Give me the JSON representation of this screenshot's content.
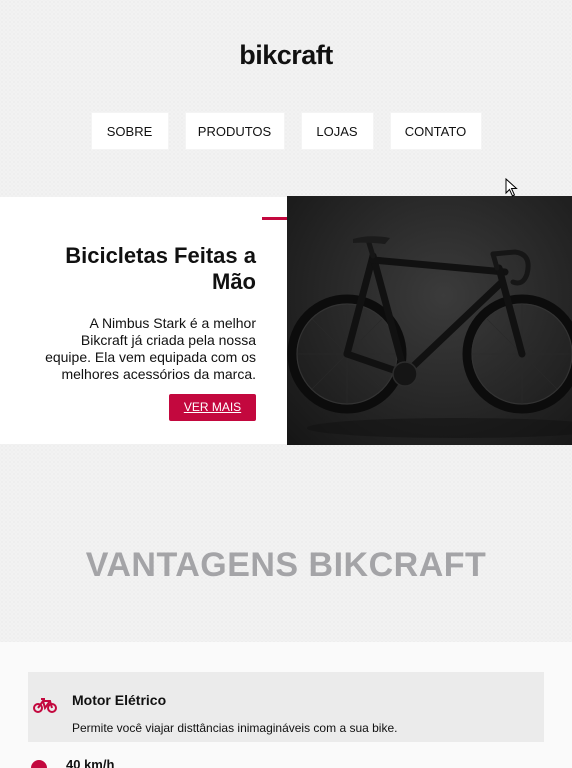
{
  "brand": {
    "logo": "bikcraft"
  },
  "nav": [
    "SOBRE",
    "PRODUTOS",
    "LOJAS",
    "CONTATO"
  ],
  "hero": {
    "title": "Bicicletas Feitas a Mão",
    "text": "A Nimbus Stark é a melhor Bikcraft já criada pela nossa equipe. Ela vem equipada com os melhores acessórios da marca.",
    "button": "VER MAIS",
    "image_icon": "road-bicycle-image"
  },
  "advantages": {
    "title": "VANTAGENS BIKCRAFT",
    "items": [
      {
        "icon": "bicycle-icon",
        "title": "Motor Elétrico",
        "text": "Permite você viajar disttâncias inimagináveis com a sua bike."
      },
      {
        "icon": "speed-icon",
        "title": "40 km/h",
        "text": ""
      }
    ]
  },
  "colors": {
    "accent": "#c3083e",
    "section_title": "#a4a4a7",
    "text": "#111111"
  }
}
